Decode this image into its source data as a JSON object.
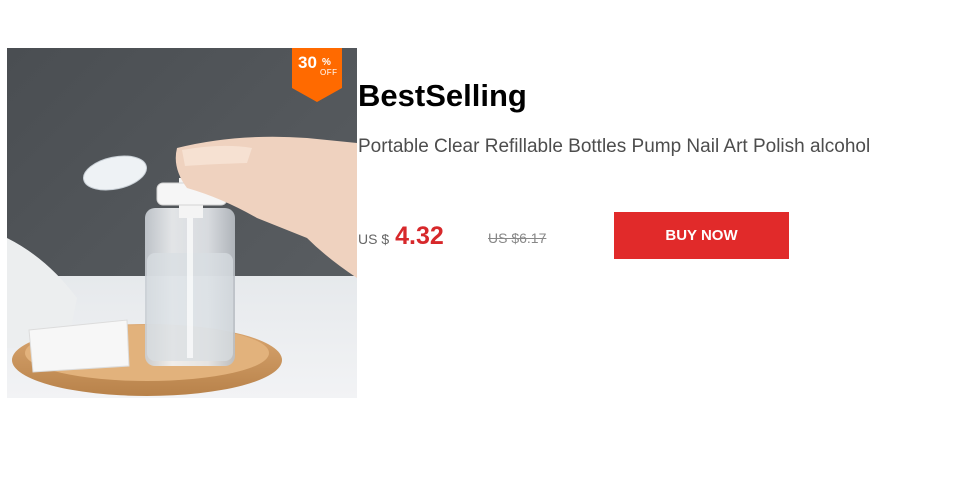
{
  "badge": {
    "number": "30",
    "percent": "%",
    "off": "OFF"
  },
  "product": {
    "headline": "BestSelling",
    "title": "Portable Clear Refillable Bottles Pump Nail Art Polish alcohol",
    "currency_label": "US $",
    "sale_price": "4.32",
    "original_price": "US $6.17",
    "buy_label": "BUY NOW"
  },
  "colors": {
    "accent_red": "#e12a2a",
    "price_red": "#d7282b",
    "badge_orange": "#ff6a00"
  },
  "icons": {
    "product_photo": "pump-bottle-image"
  }
}
